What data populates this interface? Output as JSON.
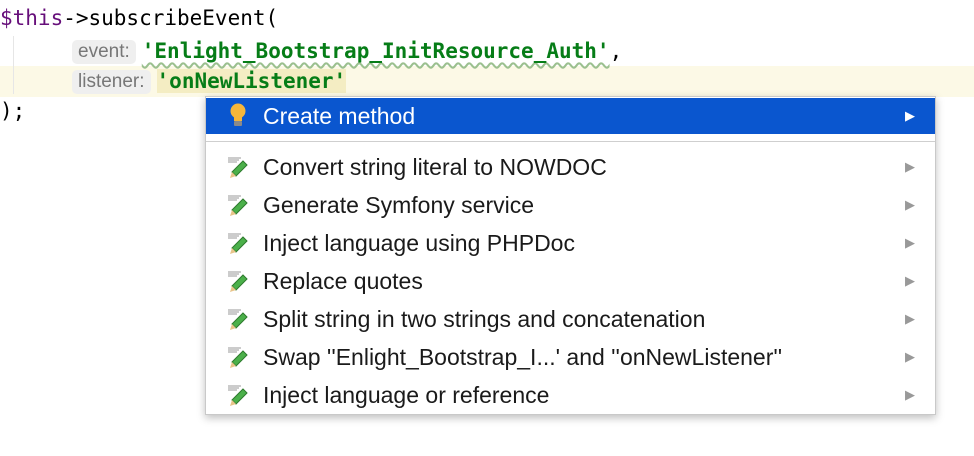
{
  "code": {
    "line1_var": "$this",
    "line1_rest": "->subscribeEvent(",
    "line2_hint": "event:",
    "line2_str": "'Enlight_Bootstrap_InitResource_Auth'",
    "line2_end": ",",
    "line3_hint": "listener:",
    "line3_str": "'onNewListener'",
    "line4": ");"
  },
  "popup": {
    "selected": {
      "label": "Create method",
      "icon": "lightbulb-icon"
    },
    "items": [
      {
        "label": "Convert string literal to NOWDOC",
        "icon": "pencil-icon"
      },
      {
        "label": "Generate Symfony service",
        "icon": "pencil-icon"
      },
      {
        "label": "Inject language using PHPDoc",
        "icon": "pencil-icon"
      },
      {
        "label": "Replace quotes",
        "icon": "pencil-icon"
      },
      {
        "label": "Split string in two strings and concatenation",
        "icon": "pencil-icon"
      },
      {
        "label": "Swap ''Enlight_Bootstrap_I...' and ''onNewListener''",
        "icon": "pencil-icon"
      },
      {
        "label": "Inject language or reference",
        "icon": "pencil-icon"
      }
    ],
    "submenu_arrow": "▶"
  },
  "colors": {
    "selection": "#0a56cf",
    "string": "#067d17",
    "variable": "#660e7a"
  }
}
